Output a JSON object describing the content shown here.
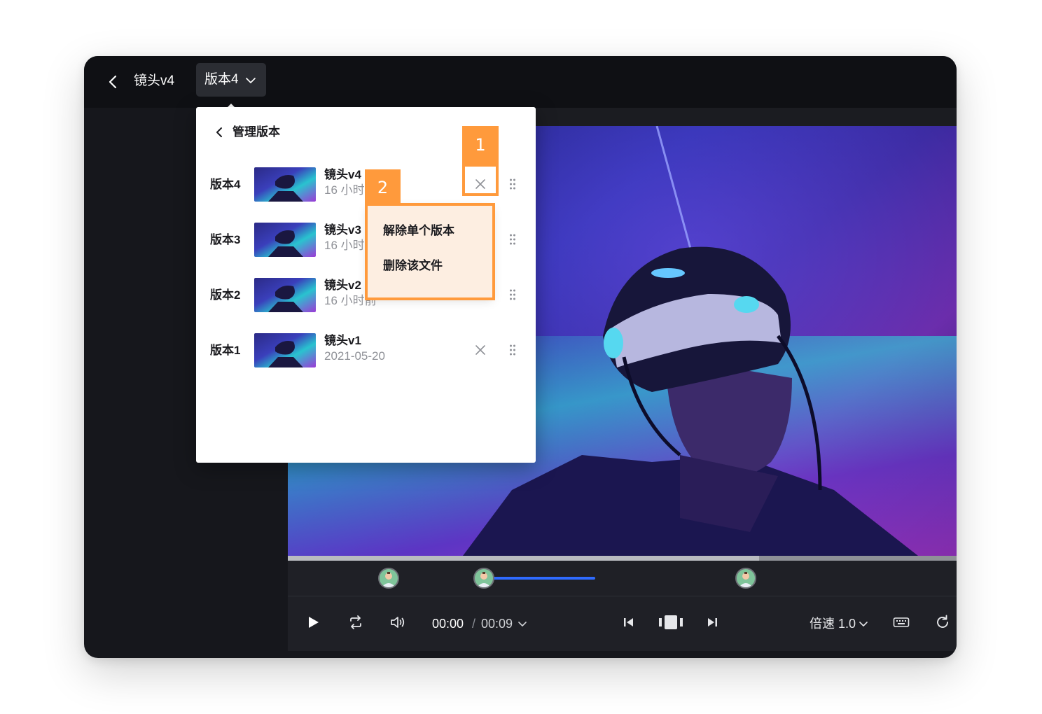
{
  "header": {
    "file_title": "镜头v4",
    "version_selector_label": "版本4"
  },
  "version_panel": {
    "title": "管理版本",
    "rows": [
      {
        "label": "版本4",
        "name": "镜头v4",
        "time": "16 小时"
      },
      {
        "label": "版本3",
        "name": "镜头v3",
        "time": "16 小时"
      },
      {
        "label": "版本2",
        "name": "镜头v2",
        "time": "16 小时前"
      },
      {
        "label": "版本1",
        "name": "镜头v1",
        "time": "2021-05-20"
      }
    ]
  },
  "context_menu": {
    "items": [
      "解除单个版本",
      "删除该文件"
    ]
  },
  "annotations": {
    "step1": "1",
    "step2": "2",
    "color": "#ff9a3c"
  },
  "player": {
    "time_current": "00:00",
    "time_separator": "/",
    "time_total": "00:09",
    "speed_label": "倍速 1.0",
    "playback_progress": 0.705,
    "comment_range": {
      "start": 0.295,
      "end": 0.46
    }
  },
  "colors": {
    "accent": "#2f6bff",
    "window_bg": "#16171c",
    "topbar_bg": "#0f1014"
  }
}
